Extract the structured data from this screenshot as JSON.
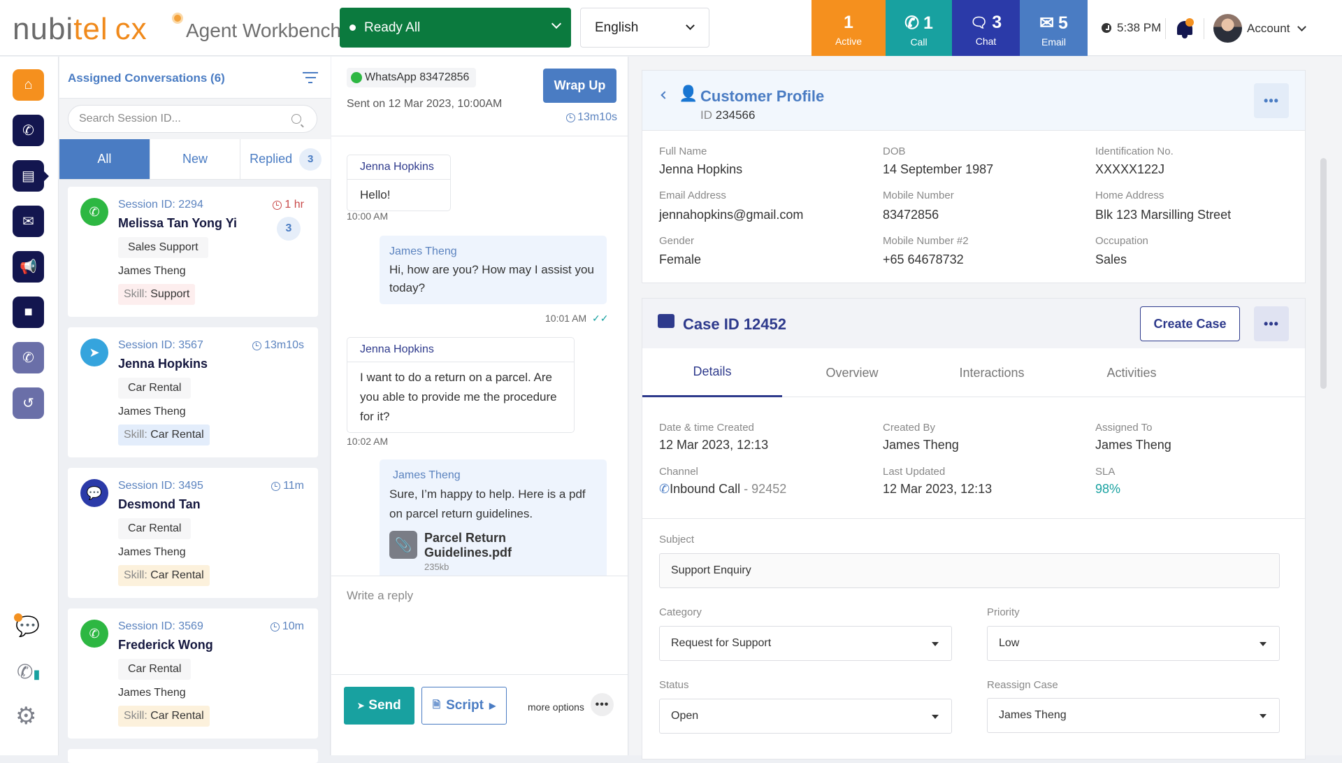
{
  "app": {
    "logo_a": "nubi",
    "logo_b": "tel",
    "logo_c": "cx",
    "title": "Agent Workbench"
  },
  "topbar": {
    "status": "Ready All",
    "language": "English",
    "stats": [
      {
        "count": "1",
        "label": "Active",
        "icon": "none",
        "color": "#f5901e"
      },
      {
        "count": "1",
        "label": "Call",
        "icon": "phone-icon",
        "color": "#18a1a0"
      },
      {
        "count": "3",
        "label": "Chat",
        "icon": "chat-icon",
        "color": "#2b3aa8"
      },
      {
        "count": "5",
        "label": "Email",
        "icon": "mail-icon",
        "color": "#4a7cc3"
      }
    ],
    "time": "5:38 PM",
    "account": "Account"
  },
  "nav": {
    "items": [
      "home",
      "phone",
      "chat",
      "email",
      "campaign",
      "contacts",
      "callback",
      "history"
    ],
    "bottom": [
      "conversations",
      "call-stats",
      "settings"
    ]
  },
  "conversations": {
    "title": "Assigned Conversations (6)",
    "search_placeholder": "Search Session ID...",
    "tabs": [
      {
        "label": "All"
      },
      {
        "label": "New"
      },
      {
        "label": "Replied",
        "badge": "3"
      }
    ],
    "items": [
      {
        "session": "Session ID: 2294",
        "name": "Melissa Tan Yong Yi",
        "queue": "Sales Support",
        "agent": "James Theng",
        "skill_key": "Skill:",
        "skill": "Support",
        "timer": "1 hr",
        "badge": "3",
        "channel": "whatsapp"
      },
      {
        "session": "Session ID: 3567",
        "name": "Jenna Hopkins",
        "queue": "Car Rental",
        "agent": "James Theng",
        "skill_key": "Skill:",
        "skill": "Car Rental",
        "timer": "13m10s",
        "channel": "telegram"
      },
      {
        "session": "Session ID: 3495",
        "name": "Desmond Tan",
        "queue": "Car Rental",
        "agent": "James Theng",
        "skill_key": "Skill:",
        "skill": "Car Rental",
        "timer": "11m",
        "channel": "webchat"
      },
      {
        "session": "Session ID: 3569",
        "name": "Frederick Wong",
        "queue": "Car Rental",
        "agent": "James Theng",
        "skill_key": "Skill:",
        "skill": "Car Rental",
        "timer": "10m",
        "channel": "whatsapp"
      }
    ]
  },
  "chat": {
    "channel_tag": "WhatsApp 83472856",
    "sent_on": "Sent on 12 Mar 2023, 10:00AM",
    "wrap_up": "Wrap Up",
    "timer": "13m10s",
    "messages": [
      {
        "from": "Jenna Hopkins",
        "text": "Hello!",
        "time": "10:00 AM"
      },
      {
        "from": "James Theng",
        "text": "Hi, how are you? How may I assist you today?",
        "time": "10:01 AM"
      },
      {
        "from": "Jenna Hopkins",
        "text": "I want to do a return on a parcel. Are you able to provide me the procedure for it?",
        "time": "10:02 AM"
      },
      {
        "from": "James Theng",
        "text": "Sure, I’m happy to help. Here is a pdf on parcel return guidelines.",
        "attachment": "Parcel Return Guidelines.pdf",
        "size": "235kb"
      }
    ],
    "reply_placeholder": "Write a reply",
    "send": "Send",
    "script": "Script",
    "more_options": "more options"
  },
  "profile": {
    "title": "Customer Profile",
    "id_label": "ID",
    "id": "234566",
    "fields": [
      {
        "label": "Full Name",
        "value": "Jenna Hopkins"
      },
      {
        "label": "DOB",
        "value": "14 September 1987"
      },
      {
        "label": "Identification No.",
        "value": "XXXXX122J"
      },
      {
        "label": "Email Address",
        "value": "jennahopkins@gmail.com"
      },
      {
        "label": "Mobile Number",
        "value": "83472856"
      },
      {
        "label": "Home Address",
        "value": "Blk 123 Marsilling Street"
      },
      {
        "label": "Gender",
        "value": "Female"
      },
      {
        "label": "Mobile Number #2",
        "value": "+65 64678732"
      },
      {
        "label": "Occupation",
        "value": "Sales"
      }
    ]
  },
  "case": {
    "title": "Case ID 12452",
    "create": "Create Case",
    "tabs": [
      "Details",
      "Overview",
      "Interactions",
      "Activities"
    ],
    "fields": [
      {
        "label": "Date & time Created",
        "value": "12 Mar 2023, 12:13"
      },
      {
        "label": "Created By",
        "value": "James Theng"
      },
      {
        "label": "Assigned To",
        "value": "James Theng"
      },
      {
        "label": "Channel",
        "value": "Inbound Call",
        "suffix": " - 92452"
      },
      {
        "label": "Last Updated",
        "value": "12 Mar 2023, 12:13"
      },
      {
        "label": "SLA",
        "value": "98%"
      }
    ],
    "subject_label": "Subject",
    "subject": "Support Enquiry",
    "category_label": "Category",
    "category": "Request for Support",
    "priority_label": "Priority",
    "priority": "Low",
    "status_label": "Status",
    "status": "Open",
    "reassign_label": "Reassign Case",
    "reassign": "James Theng"
  }
}
